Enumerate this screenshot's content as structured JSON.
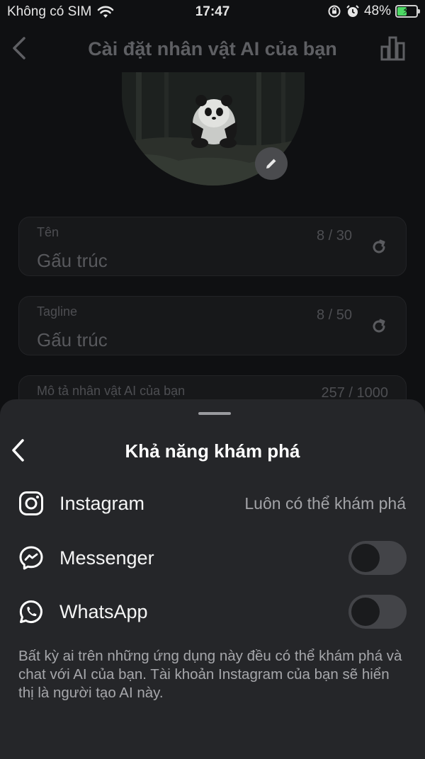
{
  "status_bar": {
    "carrier": "Không có SIM",
    "time": "17:47",
    "battery_percent": "48%",
    "battery_level": 0.48,
    "icons": [
      "wifi-icon",
      "orientation-lock-icon",
      "alarm-icon",
      "battery-charging-icon"
    ]
  },
  "header": {
    "title": "Cài đặt nhân vật AI của bạn",
    "back_icon": "chevron-left-icon",
    "stats_icon": "bar-chart-icon"
  },
  "avatar": {
    "edit_icon": "pencil-icon"
  },
  "fields": {
    "name": {
      "label": "Tên",
      "value": "Gấu trúc",
      "count": "8 / 30"
    },
    "tagline": {
      "label": "Tagline",
      "value": "Gấu trúc",
      "count": "8 / 50"
    },
    "description": {
      "label": "Mô tả nhân vật AI của bạn",
      "count": "257 / 1000"
    }
  },
  "sheet": {
    "title": "Khả năng khám phá",
    "rows": [
      {
        "label": "Instagram",
        "status": "Luôn có thể khám phá",
        "icon": "instagram-icon"
      },
      {
        "label": "Messenger",
        "enabled": false,
        "icon": "messenger-icon"
      },
      {
        "label": "WhatsApp",
        "enabled": false,
        "icon": "whatsapp-icon"
      }
    ],
    "footnote": "Bất kỳ ai trên những ứng dụng này đều có thể khám phá và chat với AI của bạn. Tài khoản Instagram của bạn sẽ hiển thị là người tạo AI này."
  },
  "colors": {
    "background": "#0f1012",
    "sheet": "#252629",
    "toggle_off": "#434448"
  }
}
